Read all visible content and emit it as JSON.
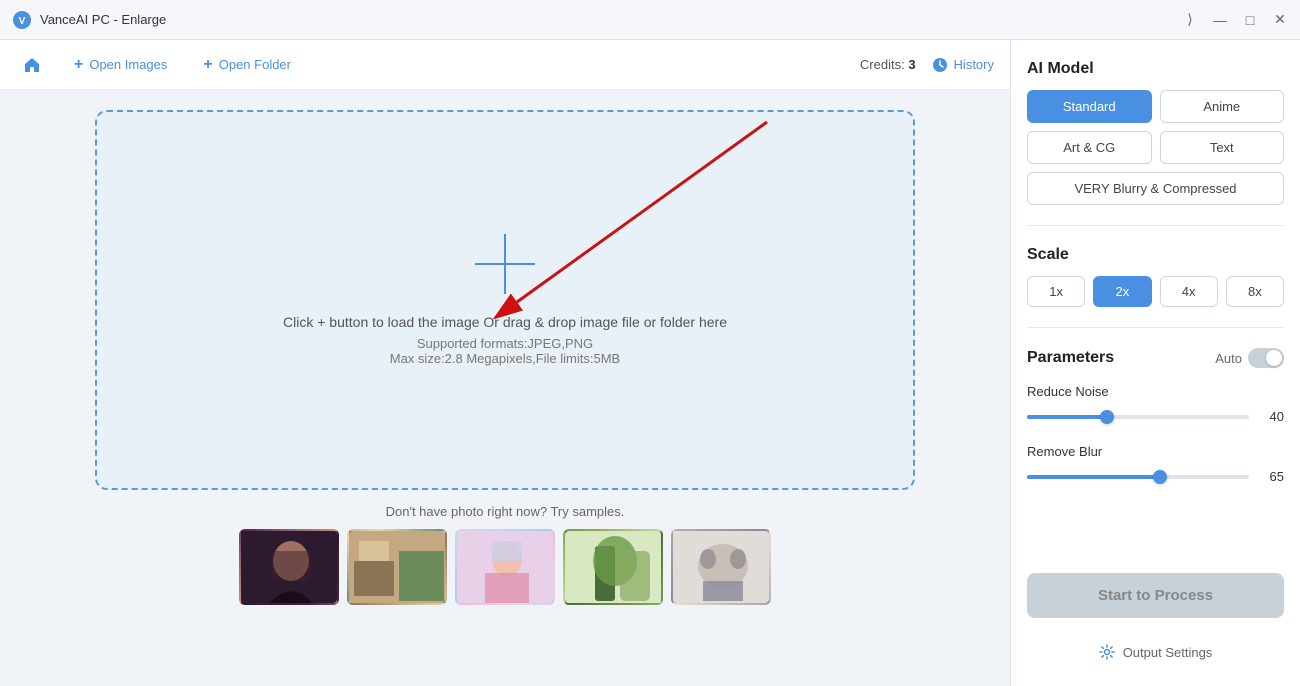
{
  "titlebar": {
    "logo_alt": "VanceAI",
    "title": "VanceAI PC - Enlarge",
    "controls": {
      "minimize": "—",
      "maximize": "□",
      "close": "✕"
    }
  },
  "toolbar": {
    "home_label": "🏠",
    "open_images_label": "Open Images",
    "open_folder_label": "Open Folder",
    "credits_prefix": "Credits:",
    "credits_value": "3",
    "history_label": "History"
  },
  "dropzone": {
    "main_text": "Click + button to load the image Or drag & drop image file or folder here",
    "sub_text1": "Supported formats:JPEG,PNG",
    "sub_text2": "Max size:2.8 Megapixels,File limits:5MB"
  },
  "samples": {
    "label": "Don't have photo right now? Try samples.",
    "items": [
      "sample1",
      "sample2",
      "sample3",
      "sample4",
      "sample5"
    ]
  },
  "right_panel": {
    "ai_model_title": "AI Model",
    "models": [
      {
        "label": "Standard",
        "active": true
      },
      {
        "label": "Anime",
        "active": false
      },
      {
        "label": "Art & CG",
        "active": false
      },
      {
        "label": "Text",
        "active": false
      },
      {
        "label": "VERY Blurry & Compressed",
        "active": false,
        "wide": true
      }
    ],
    "scale_title": "Scale",
    "scales": [
      {
        "label": "1x",
        "active": false
      },
      {
        "label": "2x",
        "active": true
      },
      {
        "label": "4x",
        "active": false
      },
      {
        "label": "8x",
        "active": false
      }
    ],
    "parameters_title": "Parameters",
    "auto_label": "Auto",
    "reduce_noise_label": "Reduce Noise",
    "reduce_noise_value": 40,
    "reduce_noise_pct": 36,
    "remove_blur_label": "Remove Blur",
    "remove_blur_value": 65,
    "remove_blur_pct": 60,
    "start_btn_label": "Start to Process",
    "output_settings_label": "Output Settings"
  }
}
